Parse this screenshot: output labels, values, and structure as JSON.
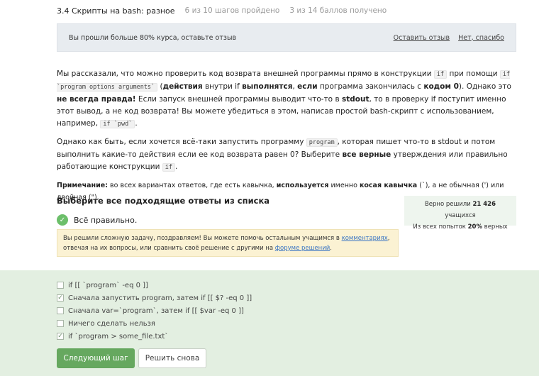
{
  "header": {
    "title": "3.4 Скрипты на bash: разное",
    "steps": "6 из 10 шагов пройдено",
    "score": "3 из 14 баллов  получено"
  },
  "review_banner": {
    "text": "Вы прошли больше 80% курса, оставьте отзыв",
    "leave_review": "Оставить отзыв",
    "no_thanks": "Нет, спасибо"
  },
  "content": {
    "p1": {
      "t1": "Мы рассказали, что можно проверить код возврата внешней программы прямо в конструкции ",
      "c1": "if",
      "t2": " при помощи ",
      "c2": "if `program options arguments`",
      "t3": " (",
      "b1": "действия",
      "t4": " внутри if ",
      "b2": "выполнятся",
      "t5": ", ",
      "b3": "если",
      "t6": " программа закончилась с ",
      "b4": "кодом 0",
      "t7": "). Однако это ",
      "b5": "не всегда правда!",
      "t8": " Если запуск внешней программы выводит что-то в ",
      "b6": "stdout",
      "t9": ", то в проверку if поступит именно этот вывод, а не код возврата! Вы можете убедиться в этом, написав простой bash-скрипт с использованием, например, ",
      "c3": "if `pwd`",
      "t10": "."
    },
    "p2": {
      "t1": "Однако как быть, если хочется всё-таки запустить программу ",
      "c1": "program",
      "t2": ", которая пишет что-то в stdout и потом выполнить какие-то действия если ее код возврата равен 0? Выберите ",
      "b1": "все верные",
      "t3": " утверждения или правильно работающие конструкции ",
      "c2": "if",
      "t4": "."
    },
    "note": {
      "label": "Примечание:",
      "t1": " во всех вариантах ответов, где есть кавычка, ",
      "b1": "используется",
      "t2": " именно ",
      "b2": "косая кавычка",
      "t3": " (`), а не обычная (') или двойная (\")."
    }
  },
  "quiz": {
    "title": "Выберите все подходящие ответы из списка",
    "correct_text": "Всё правильно.",
    "stats_line1_prefix": "Верно решили ",
    "stats_count": "21 426",
    "stats_line1_suffix": " учащихся",
    "stats_line2_prefix": "Из всех попыток ",
    "stats_percent": "20%",
    "stats_line2_suffix": " верных",
    "congrats_t1": "Вы решили сложную задачу, поздравляем! Вы можете помочь остальным учащимся в ",
    "congrats_link1": "комментариях",
    "congrats_t2": ", отвечая на их вопросы, или сравнить своё решение с другими на ",
    "congrats_link2": "форуме решений",
    "congrats_t3": ".",
    "options": [
      {
        "label": "if [[ `program` -eq 0 ]]",
        "checked": false
      },
      {
        "label": "Сначала запустить program, затем if [[ $? -eq 0 ]]",
        "checked": true
      },
      {
        "label": "Сначала var=`program`, затем if [[ $var -eq 0 ]]",
        "checked": false
      },
      {
        "label": "Ничего сделать нельзя",
        "checked": false
      },
      {
        "label": "if `program > some_file.txt`",
        "checked": true
      }
    ],
    "next_button": "Следующий шаг",
    "retry_button": "Решить снова"
  },
  "colors": {
    "accent_green": "#66a85f",
    "answers_bg": "#e3efe1",
    "congrats_bg": "#fbf2d3",
    "banner_bg": "#e8ecf0"
  }
}
